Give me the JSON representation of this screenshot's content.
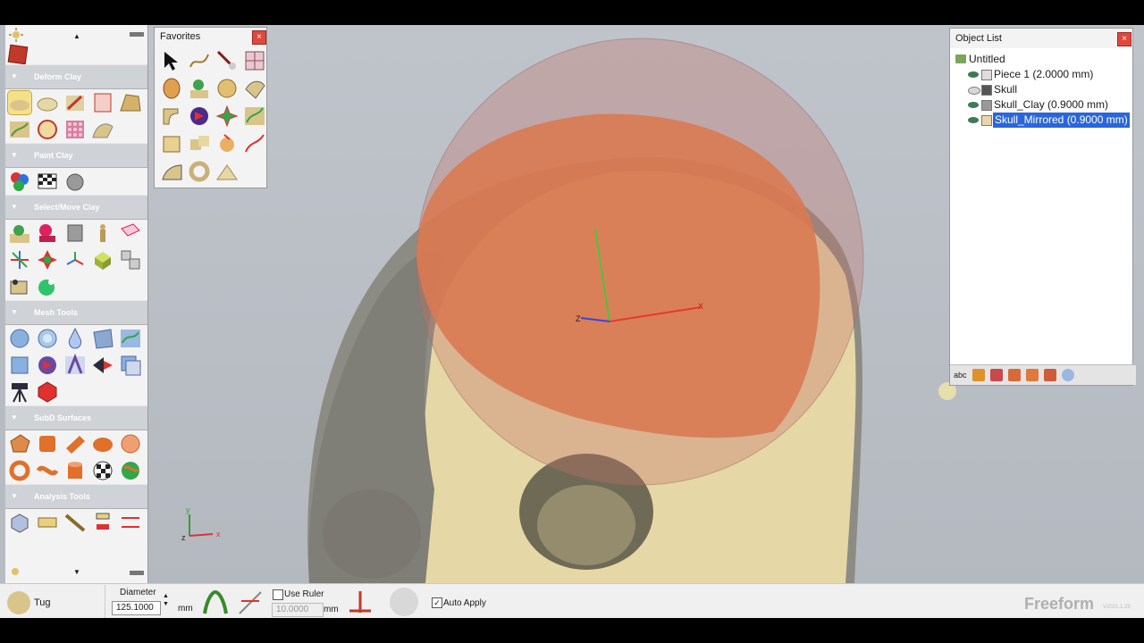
{
  "palette": {
    "sections": [
      {
        "label": "Deform Clay"
      },
      {
        "label": "Paint Clay"
      },
      {
        "label": "Select/Move Clay"
      },
      {
        "label": "Mesh Tools"
      },
      {
        "label": "SubD Surfaces"
      },
      {
        "label": "Analysis Tools"
      }
    ]
  },
  "favorites": {
    "title": "Favorites",
    "close": "×"
  },
  "object_list": {
    "title": "Object List",
    "close": "×",
    "root": "Untitled",
    "items": [
      {
        "label": "Piece 1 (2.0000 mm)",
        "visible": true
      },
      {
        "label": "Skull",
        "visible": false
      },
      {
        "label": "Skull_Clay (0.9000 mm)",
        "visible": true
      },
      {
        "label": "Skull_Mirrored (0.9000 mm)",
        "visible": true,
        "selected": true
      }
    ],
    "toolbar_label": "abc"
  },
  "viewport": {
    "axis_z": "Z",
    "axis_x": "X",
    "triad_y": "y",
    "triad_z": "z",
    "triad_x": "x"
  },
  "toolbar": {
    "tool_name": "Tug",
    "diameter_label": "Diameter",
    "diameter_value": "125.1000",
    "diameter_unit": "mm",
    "use_ruler_label": "Use Ruler",
    "ruler_value": "10.0000",
    "ruler_unit": "mm",
    "auto_apply_label": "Auto Apply",
    "auto_apply_checked": true,
    "brand": "Freeform",
    "version": "V2021.1.25"
  },
  "colors": {
    "accent": "#2a66d9",
    "clay": "#e8d9a8",
    "bone_grey": "#8b8b82",
    "sphere": "#c85a3a"
  }
}
